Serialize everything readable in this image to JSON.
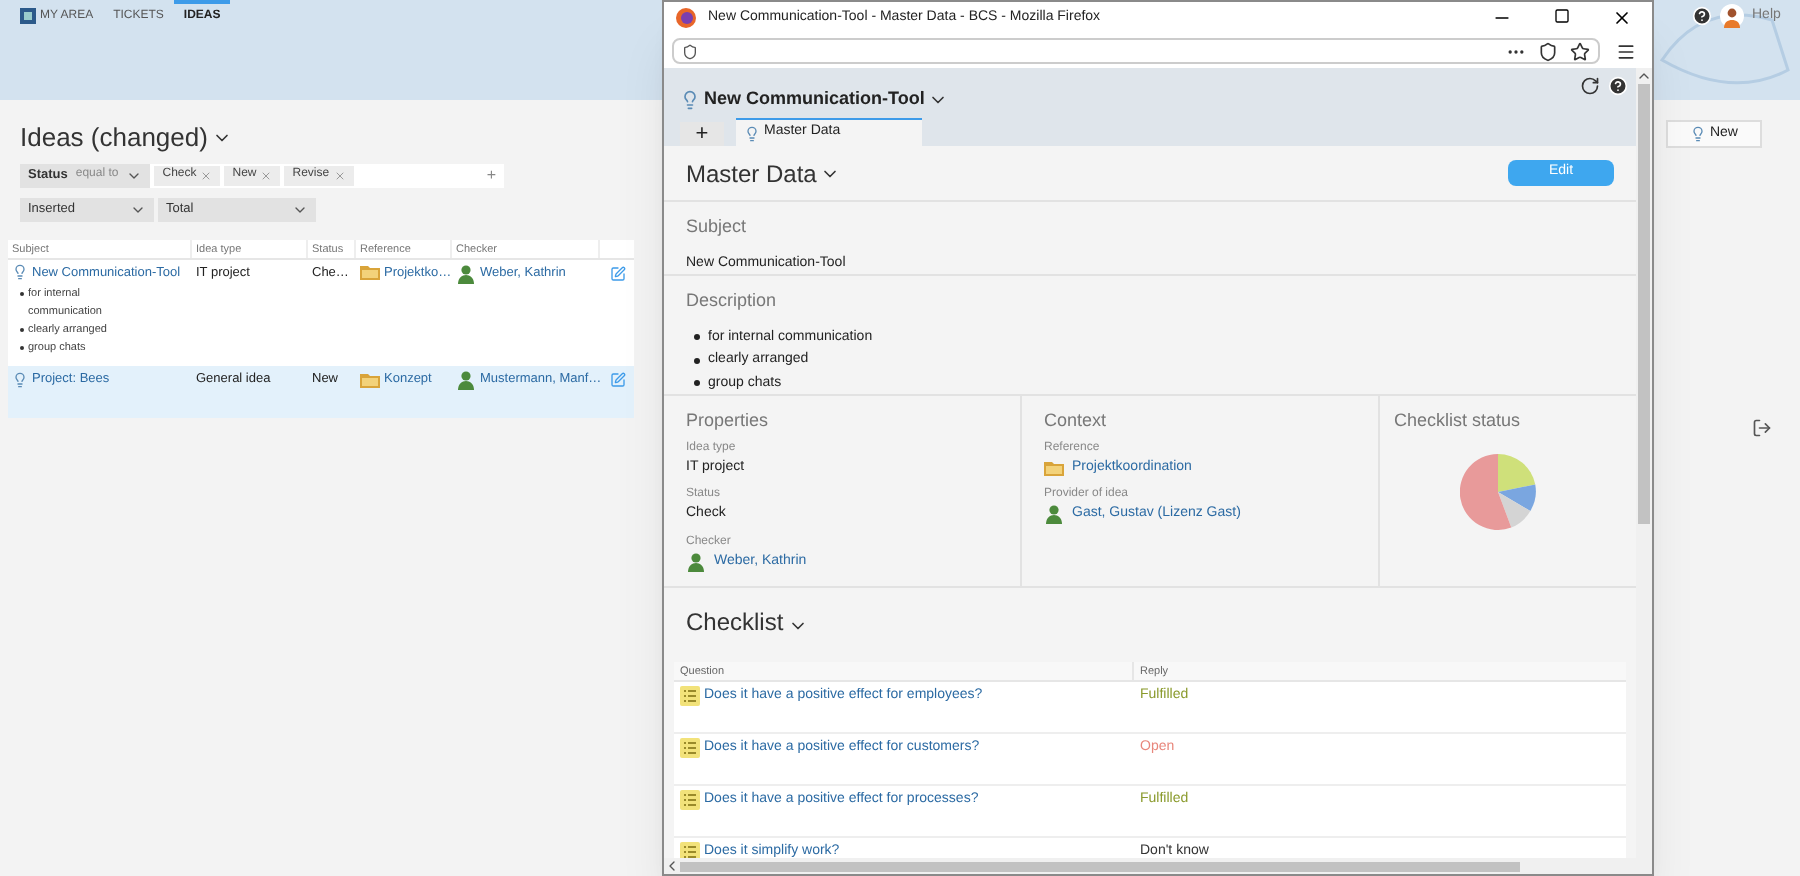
{
  "app": {
    "nav_tabs": [
      {
        "label": "MY AREA",
        "selected": false,
        "kind": "home"
      },
      {
        "label": "TICKETS",
        "selected": false,
        "kind": "plain"
      },
      {
        "label": "IDEAS",
        "selected": true,
        "kind": "plain"
      }
    ],
    "help": "Help",
    "new_button": "New"
  },
  "list": {
    "title": "Ideas (changed)",
    "filter": {
      "field": "Status",
      "operator": "equal to",
      "chips": [
        "Check",
        "New",
        "Revise"
      ],
      "add": "+"
    },
    "sort": {
      "order": "Inserted",
      "grouping": "Total"
    },
    "columns": [
      "Subject",
      "Idea type",
      "Status",
      "Reference",
      "Checker"
    ],
    "rows": [
      {
        "subject": "New Communication-Tool",
        "bullets": [
          "for internal communication",
          "clearly arranged",
          "group chats"
        ],
        "idea_type": "IT project",
        "status": "Che…",
        "reference": "Projektko…",
        "checker": "Weber, Kathrin",
        "selected": false
      },
      {
        "subject": "Project: Bees",
        "idea_type": "General idea",
        "status": "New",
        "reference": "Konzept",
        "checker": "Mustermann, Manf…",
        "selected": true
      }
    ]
  },
  "popup": {
    "window_title": "New Communication-Tool - Master Data - BCS - Mozilla Firefox",
    "record_title": "New Communication-Tool",
    "add_tab": "+",
    "tabs": [
      {
        "label": "Master Data",
        "selected": true
      }
    ],
    "section_title": "Master Data",
    "edit_button": "Edit",
    "subject": {
      "heading": "Subject",
      "value": "New Communication-Tool"
    },
    "description": {
      "heading": "Description",
      "bullets": [
        "for internal communication",
        "clearly arranged",
        "group chats"
      ]
    },
    "properties": {
      "heading": "Properties",
      "fields": [
        {
          "label": "Idea type",
          "value": "IT project",
          "kind": "text"
        },
        {
          "label": "Status",
          "value": "Check",
          "kind": "text"
        },
        {
          "label": "Checker",
          "value": "Weber, Kathrin",
          "kind": "person"
        }
      ]
    },
    "context": {
      "heading": "Context",
      "fields": [
        {
          "label": "Reference",
          "value": "Projektkoordination",
          "kind": "reference"
        },
        {
          "label": "Provider of idea",
          "value": "Gast, Gustav (Lizenz Gast)",
          "kind": "person"
        }
      ]
    },
    "checklist_status": {
      "heading": "Checklist status"
    },
    "checklist": {
      "title": "Checklist",
      "columns": [
        "Question",
        "Reply"
      ],
      "rows": [
        {
          "question": "Does it have a positive effect for employees?",
          "reply": "Fulfilled",
          "color": "#8a9a2c"
        },
        {
          "question": "Does it have a positive effect for customers?",
          "reply": "Open",
          "color": "#e8877c"
        },
        {
          "question": "Does it have a positive effect for processes?",
          "reply": "Fulfilled",
          "color": "#8a9a2c"
        },
        {
          "question": "Does it simplify work?",
          "reply": "Don't know",
          "color": "#333333"
        }
      ]
    }
  }
}
